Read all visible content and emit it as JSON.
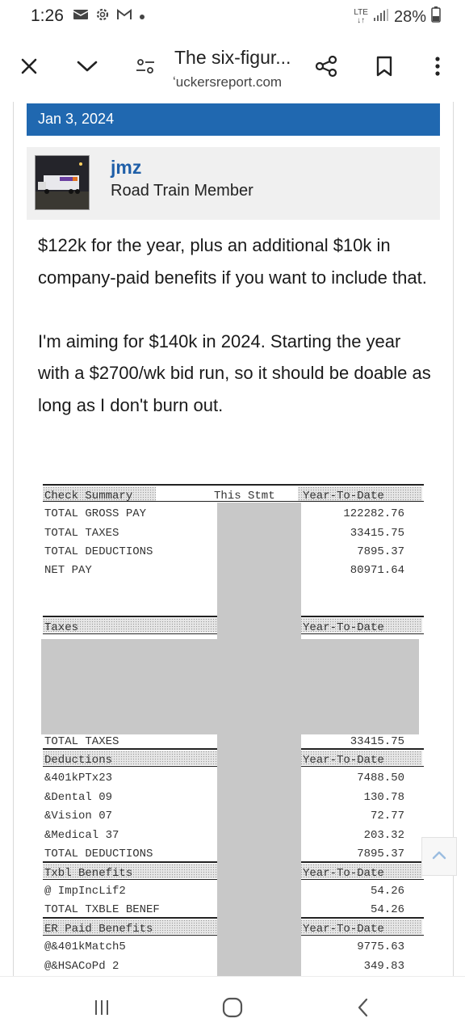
{
  "status_bar": {
    "time": "1:26",
    "network": "LTE",
    "battery": "28%",
    "icons": [
      "gallery-icon",
      "settings-icon",
      "gmail-icon",
      "dot-icon"
    ]
  },
  "browser_toolbar": {
    "page_title": "The six-figur...",
    "url_host": "ʻuckersreport.com",
    "icons": [
      "close-icon",
      "chevron-down-icon",
      "page-options-icon",
      "share-icon",
      "bookmark-icon",
      "more-vert-icon"
    ]
  },
  "post": {
    "date": "Jan 3, 2024",
    "username": "jmz",
    "user_title": "Road Train Member",
    "paragraphs": [
      "$122k for the year, plus an additional $10k in company-paid benefits if you want to include that.",
      "I'm aiming for $140k in 2024. Starting the year with a $2700/wk bid run, so it should be doable as long as I don't burn out."
    ]
  },
  "paystub": {
    "check_summary": {
      "header": "Check Summary",
      "col_this": "This Stmt",
      "col_ytd": "Year-To-Date",
      "rows": [
        {
          "label": "TOTAL GROSS PAY",
          "ytd": "122282.76"
        },
        {
          "label": "TOTAL TAXES",
          "ytd": "33415.75"
        },
        {
          "label": "TOTAL DEDUCTIONS",
          "ytd": "7895.37"
        },
        {
          "label": "NET PAY",
          "ytd": "80971.64"
        }
      ]
    },
    "taxes": {
      "header": "Taxes",
      "col_ytd": "Year-To-Date",
      "total_label": "TOTAL TAXES",
      "total_ytd": "33415.75"
    },
    "deductions": {
      "header": "Deductions",
      "col_ytd": "Year-To-Date",
      "rows": [
        {
          "label": "&401kPTx23",
          "ytd": "7488.50"
        },
        {
          "label": "&Dental 09",
          "ytd": "130.78"
        },
        {
          "label": "&Vision 07",
          "ytd": "72.77"
        },
        {
          "label": "&Medical 37",
          "ytd": "203.32"
        }
      ],
      "total_label": "TOTAL DEDUCTIONS",
      "total_ytd": "7895.37"
    },
    "txbl_benefits": {
      "header": "Txbl Benefits",
      "col_ytd": "Year-To-Date",
      "rows": [
        {
          "label": "@ ImpIncLif2",
          "ytd": "54.26"
        }
      ],
      "total_label": "TOTAL TXBLE BENEF",
      "total_ytd": "54.26"
    },
    "er_paid_benefits": {
      "header": "ER Paid Benefits",
      "col_ytd": "Year-To-Date",
      "rows": [
        {
          "label": "@&401kMatch5",
          "ytd": "9775.63"
        },
        {
          "label": "@&HSACoPd 2",
          "ytd": "349.83"
        }
      ]
    }
  },
  "nav_bar": {
    "icons": [
      "recent-apps-icon",
      "home-icon",
      "back-icon"
    ]
  }
}
